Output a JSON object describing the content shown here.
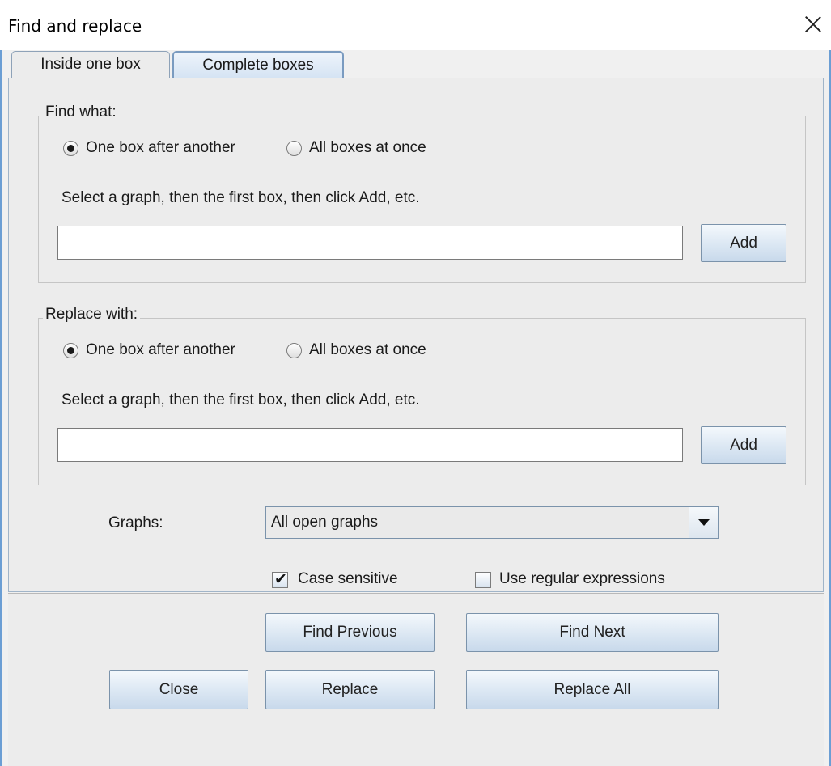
{
  "window": {
    "title": "Find and replace"
  },
  "tabs": [
    {
      "label": "Inside one box",
      "selected": false
    },
    {
      "label": "Complete boxes",
      "selected": true
    }
  ],
  "find": {
    "group_title": "Find what:",
    "radio_one": "One box after another",
    "radio_all": "All boxes at once",
    "selected": "One box after another",
    "hint": "Select a graph, then the first box, then click Add, etc.",
    "input_value": "",
    "add_label": "Add"
  },
  "replace": {
    "group_title": "Replace with:",
    "radio_one": "One box after another",
    "radio_all": "All boxes at once",
    "selected": "One box after another",
    "hint": "Select a graph, then the first box, then click Add, etc.",
    "input_value": "",
    "add_label": "Add"
  },
  "graphs": {
    "label": "Graphs:",
    "selected": "All open graphs"
  },
  "options": {
    "case_sensitive": {
      "label": "Case sensitive",
      "checked": true
    },
    "regex": {
      "label": "Use regular expressions",
      "checked": false
    }
  },
  "buttons": {
    "find_previous": "Find Previous",
    "find_next": "Find Next",
    "close": "Close",
    "replace": "Replace",
    "replace_all": "Replace All"
  },
  "icons": {
    "close": "close-icon",
    "dropdown": "chevron-down-icon",
    "check": "checkmark-icon"
  },
  "colors": {
    "accent": "#6b9ed4",
    "button_top": "#f4f8fc",
    "button_bottom": "#c8d9eb"
  }
}
